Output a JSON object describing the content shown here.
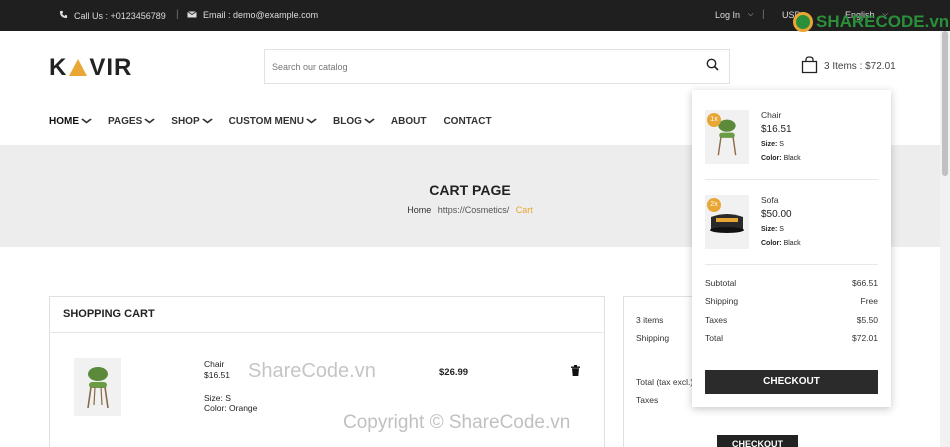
{
  "topbar": {
    "phone": "Call Us : +0123456789",
    "email": "Email : demo@example.com",
    "login": "Log In",
    "currency": "USD",
    "language": "English"
  },
  "header": {
    "logo_left": "K",
    "logo_right": "VIR",
    "search_placeholder": "Search our catalog",
    "cart_summary": "3 Items : $72.01"
  },
  "nav": [
    {
      "label": "HOME",
      "dropdown": true
    },
    {
      "label": "PAGES",
      "dropdown": true
    },
    {
      "label": "SHOP",
      "dropdown": true
    },
    {
      "label": "CUSTOM MENU",
      "dropdown": true
    },
    {
      "label": "BLOG",
      "dropdown": true
    },
    {
      "label": "ABOUT",
      "dropdown": false
    },
    {
      "label": "CONTACT",
      "dropdown": false
    }
  ],
  "banner": {
    "title": "CART PAGE",
    "crumb_home": "Home",
    "crumb_mid": "https://Cosmetics/",
    "crumb_current": "Cart"
  },
  "cart": {
    "title": "SHOPPING CART",
    "item": {
      "name": "Chair",
      "unit_price": "$16.51",
      "size": "Size: S",
      "color": "Color: Orange",
      "total": "$26.99"
    }
  },
  "summary": {
    "items": "3 items",
    "shipping": "Shipping",
    "total_label": "Total (tax excl.)",
    "taxes": "Taxes",
    "checkout": "CHECKOUT"
  },
  "dropdown": {
    "items": [
      {
        "qty": "1x",
        "name": "Chair",
        "price": "$16.51",
        "size_label": "Size:",
        "size": "S",
        "color_label": "Color:",
        "color": "Black"
      },
      {
        "qty": "2x",
        "name": "Sofa",
        "price": "$50.00",
        "size_label": "Size:",
        "size": "S",
        "color_label": "Color:",
        "color": "Black"
      }
    ],
    "subtotal_label": "Subtotal",
    "subtotal": "$66.51",
    "shipping_label": "Shipping",
    "shipping": "Free",
    "taxes_label": "Taxes",
    "taxes": "$5.50",
    "total_label": "Total",
    "total": "$72.01",
    "checkout": "CHECKOUT"
  },
  "watermarks": {
    "logo": "SHARECODE.vn",
    "middle": "ShareCode.vn",
    "bottom": "Copyright © ShareCode.vn"
  },
  "colors": {
    "accent": "#e8a735",
    "dark": "#1f1f1f",
    "watermark_green": "#2a8f3a"
  },
  "icons": [
    "phone-icon",
    "mail-icon",
    "search-icon",
    "shopping-bag-icon",
    "trash-icon",
    "chevron-down-icon"
  ]
}
